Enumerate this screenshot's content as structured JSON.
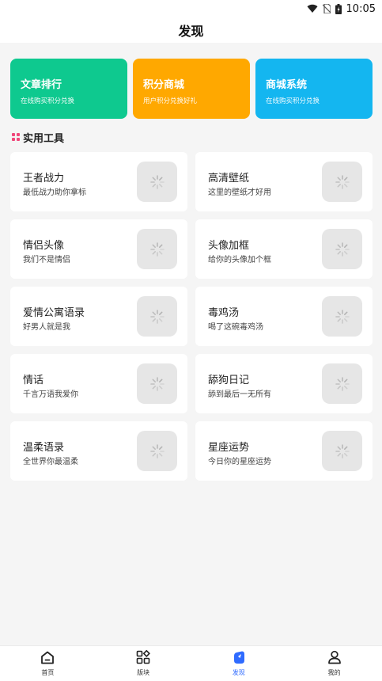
{
  "status": {
    "time": "10:05",
    "icons": [
      "wifi-icon",
      "no-sim-icon",
      "battery-icon"
    ]
  },
  "header": {
    "title": "发现"
  },
  "banners": [
    {
      "title": "文章排行",
      "subtitle": "在线购买积分兑换",
      "color": "#0ec98f"
    },
    {
      "title": "积分商城",
      "subtitle": "用户积分兑换好礼",
      "color": "#ffa800"
    },
    {
      "title": "商城系统",
      "subtitle": "在线购买积分兑换",
      "color": "#14b6f0"
    }
  ],
  "section": {
    "title": "实用工具"
  },
  "tools": [
    {
      "name": "王者战力",
      "desc": "最低战力助你拿标"
    },
    {
      "name": "高清壁纸",
      "desc": "这里的壁纸才好用"
    },
    {
      "name": "情侣头像",
      "desc": "我们不是情侣"
    },
    {
      "name": "头像加框",
      "desc": "给你的头像加个框"
    },
    {
      "name": "爱情公寓语录",
      "desc": "好男人就是我"
    },
    {
      "name": "毒鸡汤",
      "desc": "喝了这碗毒鸡汤"
    },
    {
      "name": "情话",
      "desc": "千言万语我爱你"
    },
    {
      "name": "舔狗日记",
      "desc": "舔到最后一无所有"
    },
    {
      "name": "温柔语录",
      "desc": "全世界你最温柔"
    },
    {
      "name": "星座运势",
      "desc": "今日你的星座运势"
    }
  ],
  "tabbar": [
    {
      "label": "首页",
      "icon": "home-icon",
      "active": false
    },
    {
      "label": "版块",
      "icon": "grid-icon",
      "active": false
    },
    {
      "label": "发现",
      "icon": "discover-icon",
      "active": true
    },
    {
      "label": "我的",
      "icon": "user-icon",
      "active": false
    }
  ],
  "colors": {
    "accent": "#2f6bff",
    "section_icon": "#f0477a"
  }
}
